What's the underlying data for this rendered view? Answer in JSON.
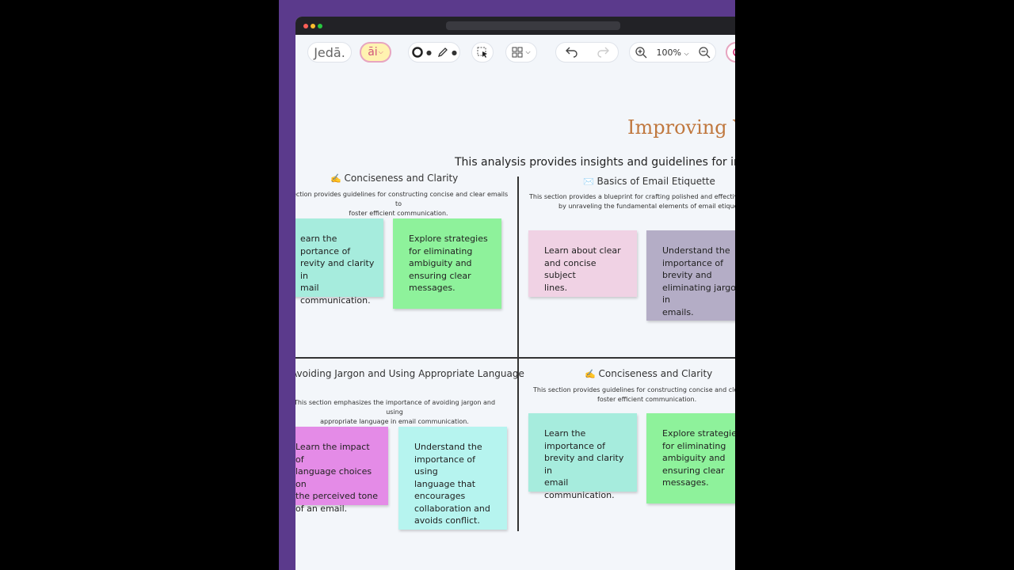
{
  "toolbar": {
    "logo": "Jedā.",
    "ai_label": "āi",
    "zoom_level": "100%"
  },
  "canvas": {
    "title": "Improving Yo",
    "subtitle": "This analysis provides insights and guidelines for impro",
    "sections": [
      {
        "emoji": "✍️",
        "title": "Conciseness and Clarity",
        "desc_line1": "section provides guidelines for constructing concise and clear emails to",
        "desc_line2": "foster efficient communication.",
        "notes": [
          {
            "text": "earn the\nportance of\nrevity and clarity in\nmail communication.",
            "color": "#a6ecdd"
          },
          {
            "text": "Explore strategies\nfor eliminating\nambiguity and\nensuring clear\nmessages.",
            "color": "#8ef29b"
          }
        ]
      },
      {
        "emoji": "✉️",
        "title": "Basics of Email Etiquette",
        "desc_line1": "This section provides a blueprint for crafting polished and effective mes",
        "desc_line2": "by unraveling the fundamental elements of email etiquette.",
        "notes": [
          {
            "text": "Learn about clear\nand concise subject\nlines.",
            "color": "#f0d2e4"
          },
          {
            "text": "Understand the\nimportance of\nbrevity and\neliminating jargon in\nemails.",
            "color": "#b4adc6"
          }
        ]
      },
      {
        "emoji": "",
        "title": "Avoiding Jargon and Using Appropriate Language",
        "desc_line1": "This section emphasizes the importance of avoiding jargon and using",
        "desc_line2": "appropriate language in email communication.",
        "notes": [
          {
            "text": "Learn the impact of\nlanguage choices on\nthe perceived tone\nof an email.",
            "color": "#e48be7"
          },
          {
            "text": "Understand the\nimportance of using\nlanguage that\nencourages\ncollaboration and\navoids conflict.",
            "color": "#b6f4ef"
          }
        ]
      },
      {
        "emoji": "✍️",
        "title": "Conciseness and Clarity",
        "desc_line1": "This section provides guidelines for constructing concise and clear ema",
        "desc_line2": "foster efficient communication.",
        "notes": [
          {
            "text": "Learn the\nimportance of\nbrevity and clarity in\nemail communication.",
            "color": "#a6ecdd"
          },
          {
            "text": "Explore strategies\nfor eliminating\nambiguity and\nensuring clear\nmessages.",
            "color": "#8ef29b"
          }
        ]
      }
    ]
  },
  "colors": {
    "background": "#000000",
    "frame": "#5b3a8c",
    "canvas": "#f3f6fa",
    "title_accent": "#c0783f"
  }
}
